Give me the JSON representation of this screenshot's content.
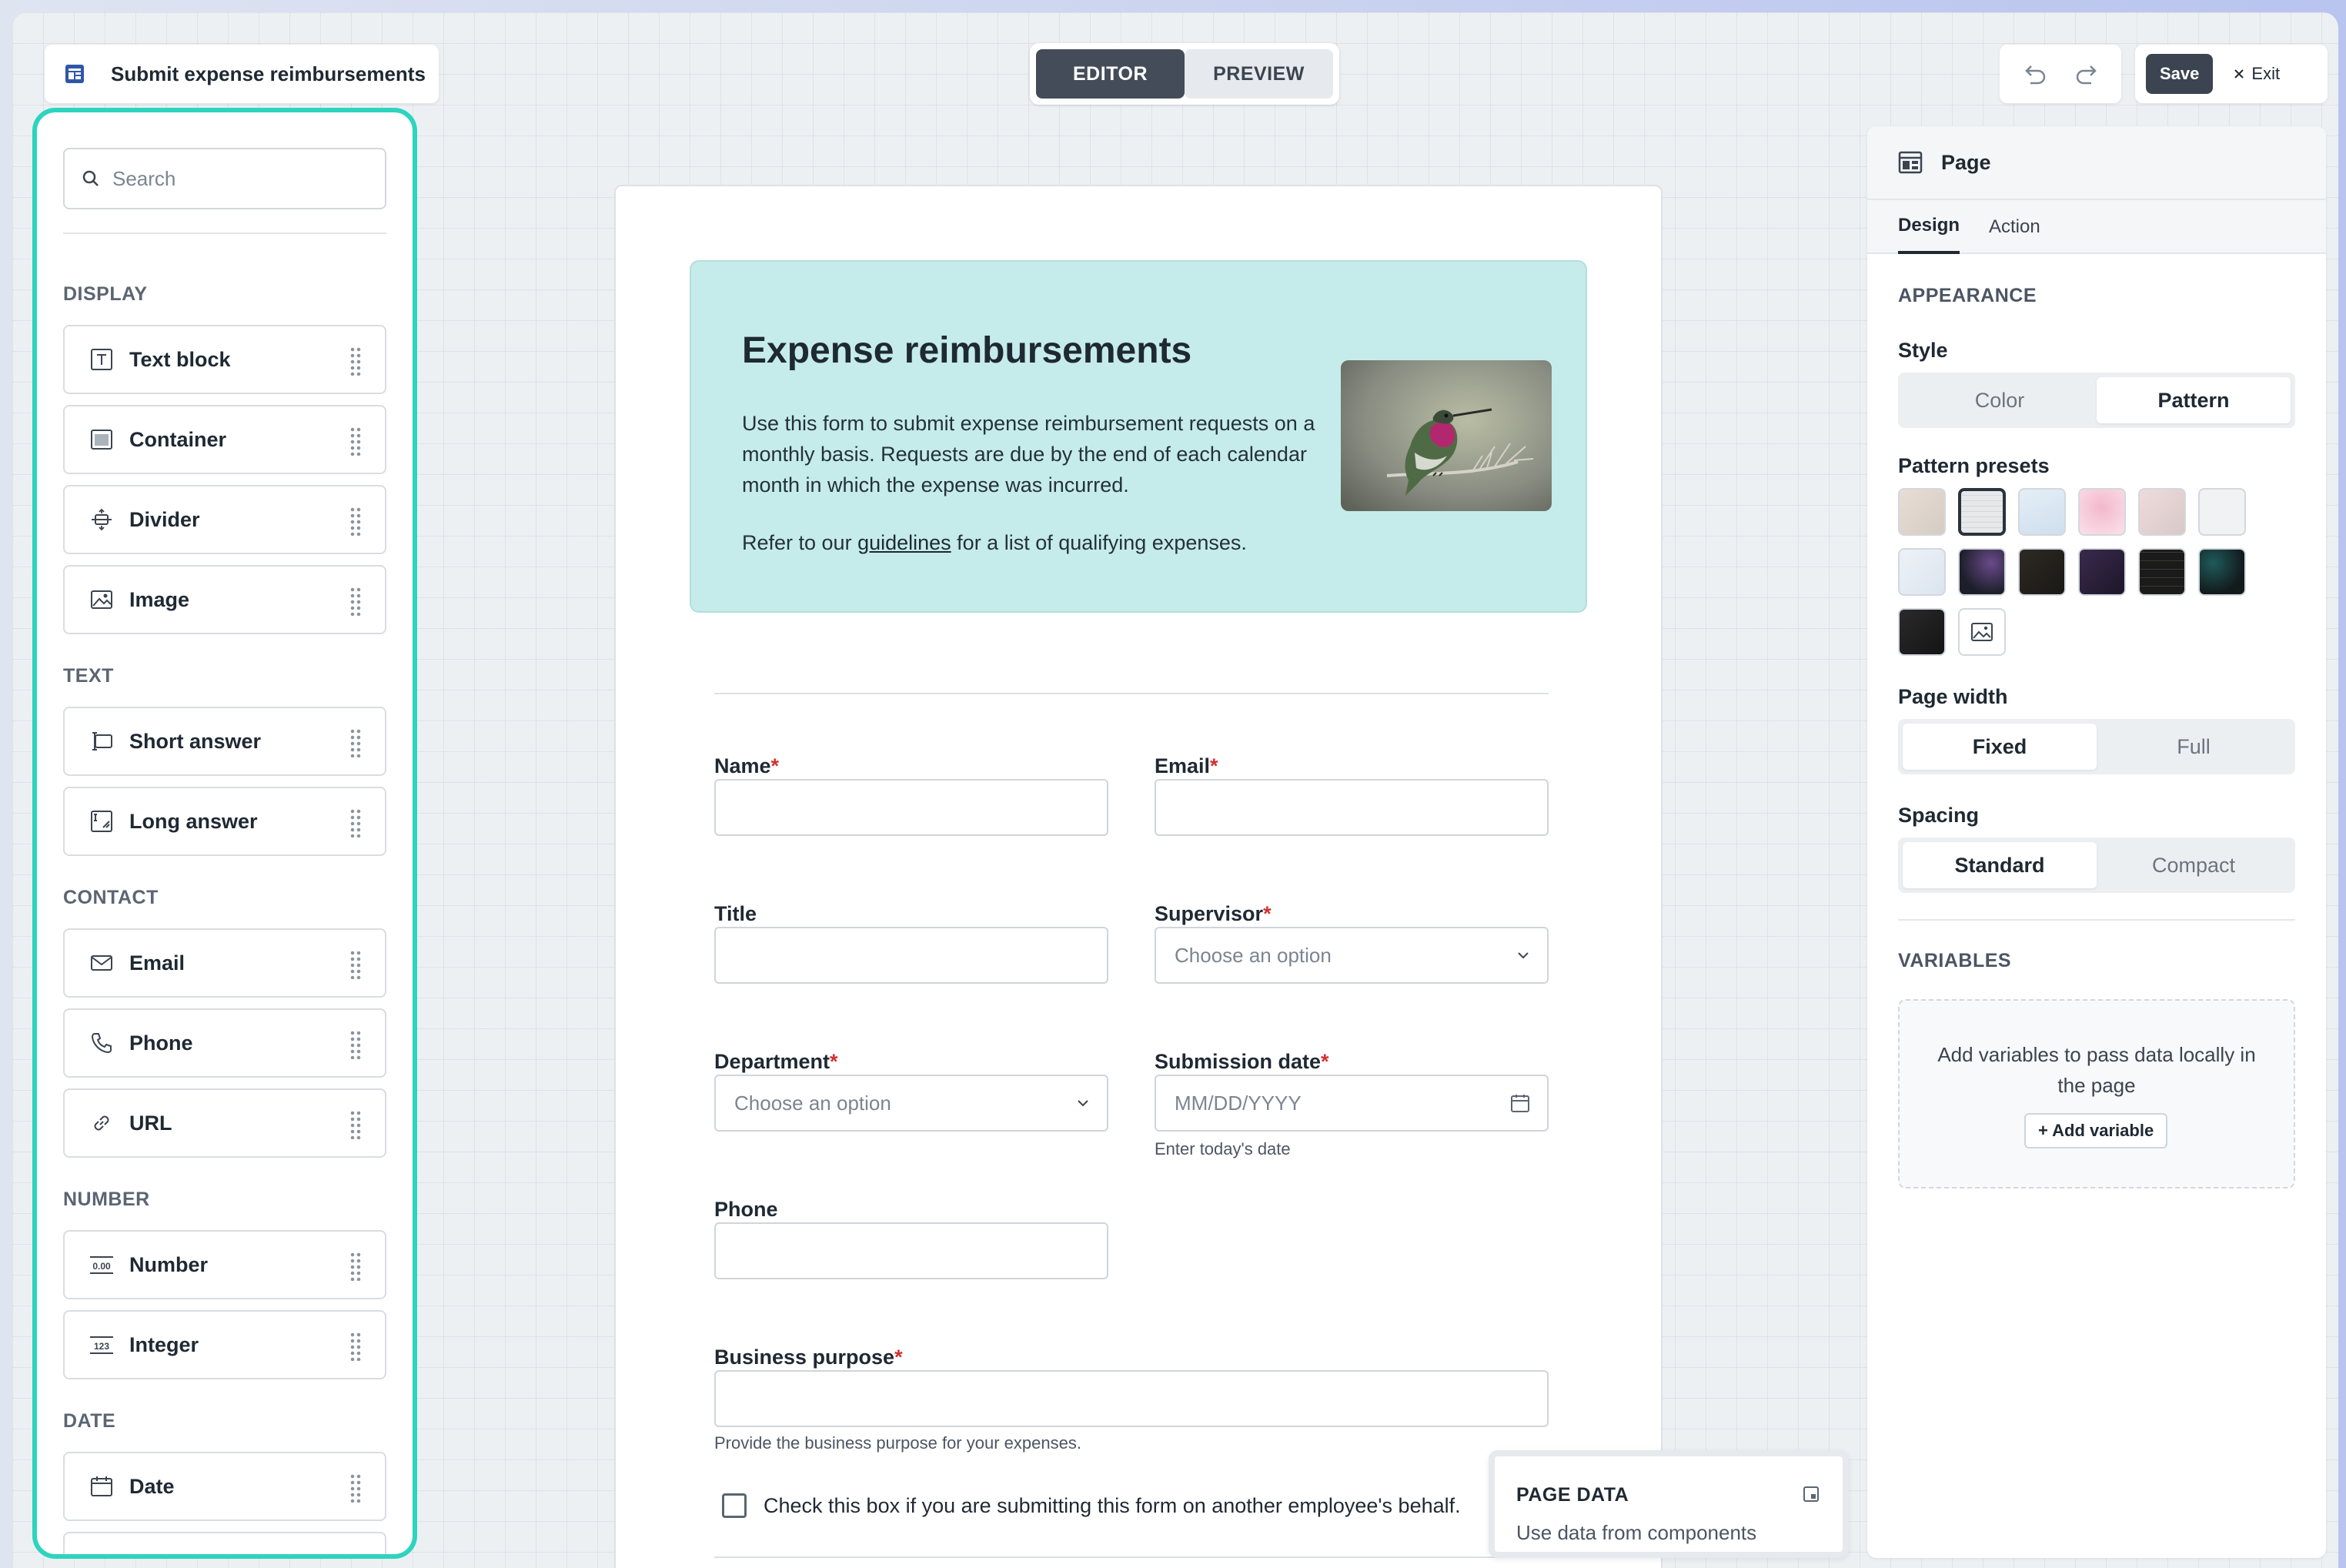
{
  "app": {
    "title": "Submit expense reimbursements",
    "mode_tabs": [
      "EDITOR",
      "PREVIEW"
    ],
    "active_mode": "EDITOR",
    "save_label": "Save",
    "exit_label": "Exit"
  },
  "palette": {
    "search_placeholder": "Search",
    "categories": [
      {
        "label": "DISPLAY",
        "items": [
          {
            "label": "Text block",
            "icon": "text-block-icon"
          },
          {
            "label": "Container",
            "icon": "container-icon"
          },
          {
            "label": "Divider",
            "icon": "divider-icon"
          },
          {
            "label": "Image",
            "icon": "image-icon"
          }
        ]
      },
      {
        "label": "TEXT",
        "items": [
          {
            "label": "Short answer",
            "icon": "short-answer-icon"
          },
          {
            "label": "Long answer",
            "icon": "long-answer-icon"
          }
        ]
      },
      {
        "label": "CONTACT",
        "items": [
          {
            "label": "Email",
            "icon": "email-icon"
          },
          {
            "label": "Phone",
            "icon": "phone-icon"
          },
          {
            "label": "URL",
            "icon": "link-icon"
          }
        ]
      },
      {
        "label": "NUMBER",
        "items": [
          {
            "label": "Number",
            "icon": "number-icon"
          },
          {
            "label": "Integer",
            "icon": "integer-icon"
          }
        ]
      },
      {
        "label": "DATE",
        "items": [
          {
            "label": "Date",
            "icon": "calendar-icon"
          }
        ]
      }
    ]
  },
  "form": {
    "hero": {
      "title": "Expense reimbursements",
      "body": "Use this form to submit expense reimbursement requests on a monthly basis. Requests are due by the end of each calendar month in which the expense was incurred.",
      "guidelines_prefix": "Refer to our ",
      "guidelines_link": "guidelines",
      "guidelines_suffix": " for a list of qualifying expenses."
    },
    "fields": {
      "name": {
        "label": "Name",
        "required": "*"
      },
      "email": {
        "label": "Email",
        "required": "*"
      },
      "title": {
        "label": "Title"
      },
      "supervisor": {
        "label": "Supervisor",
        "required": "*",
        "placeholder": "Choose an option"
      },
      "department": {
        "label": "Department",
        "required": "*",
        "placeholder": "Choose an option"
      },
      "submission_date": {
        "label": "Submission date",
        "required": "*",
        "placeholder": "MM/DD/YYYY",
        "help": "Enter today's date"
      },
      "phone": {
        "label": "Phone"
      },
      "business_purpose": {
        "label": "Business purpose",
        "required": "*",
        "help": "Provide the business purpose for your expenses."
      }
    },
    "checkbox_label": "Check this box if you are submitting this form on another employee's behalf."
  },
  "page_data": {
    "title": "PAGE DATA",
    "subtitle": "Use data from components"
  },
  "inspector": {
    "title": "Page",
    "tabs": [
      "Design",
      "Action"
    ],
    "active_tab": "Design",
    "appearance_label": "APPEARANCE",
    "style_label": "Style",
    "style_options": [
      "Color",
      "Pattern"
    ],
    "style_selected": "Pattern",
    "pattern_presets_label": "Pattern presets",
    "page_width_label": "Page width",
    "page_width_options": [
      "Fixed",
      "Full"
    ],
    "page_width_selected": "Fixed",
    "spacing_label": "Spacing",
    "spacing_options": [
      "Standard",
      "Compact"
    ],
    "spacing_selected": "Standard",
    "variables_label": "VARIABLES",
    "variables_empty": "Add variables to pass data locally in the page",
    "add_variable_label": "+ Add variable"
  },
  "colors": {
    "accent": "#2dd4bf",
    "hero_bg": "#c5ecea",
    "required": "#d32f2f",
    "dark_button": "#3b4450"
  }
}
